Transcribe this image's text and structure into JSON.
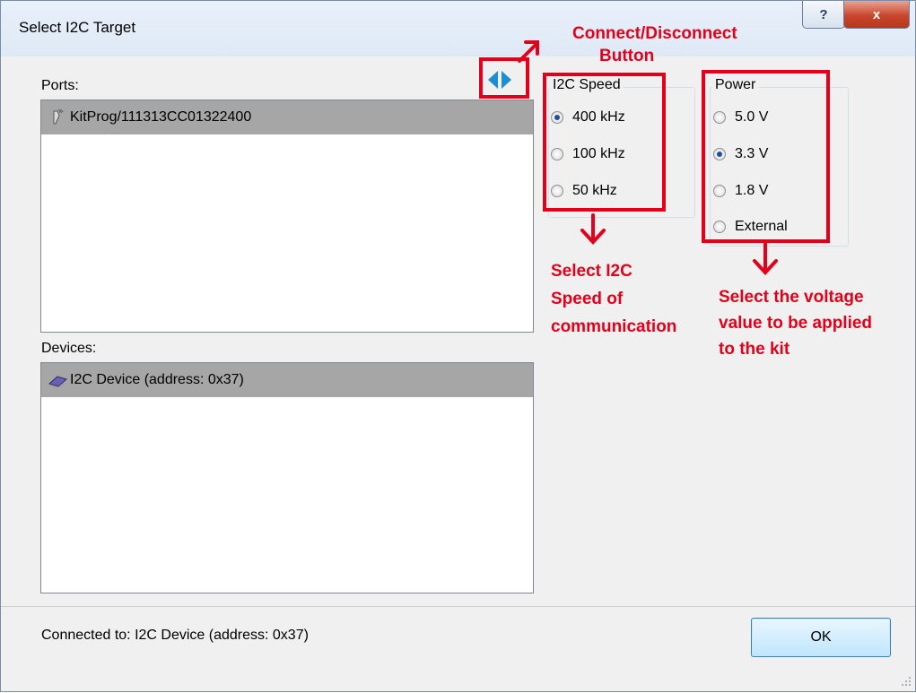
{
  "window": {
    "title": "Select I2C Target",
    "help_label": "?",
    "close_label": "x"
  },
  "ports": {
    "label": "Ports:",
    "items": [
      "KitProg/111313CC01322400"
    ]
  },
  "devices": {
    "label": "Devices:",
    "items": [
      "I2C Device (address: 0x37)"
    ]
  },
  "i2c_speed": {
    "title": "I2C Speed",
    "options": [
      "400 kHz",
      "100 kHz",
      "50 kHz"
    ],
    "selected": "400 kHz"
  },
  "power": {
    "title": "Power",
    "options": [
      "5.0 V",
      "3.3 V",
      "1.8 V",
      "External"
    ],
    "selected": "3.3 V"
  },
  "annotations": {
    "connect_line1": "Connect/Disconnect",
    "connect_line2": "Button",
    "speed_line1": "Select I2C",
    "speed_line2": "Speed of",
    "speed_line3": "communication",
    "power_line1": "Select the voltage",
    "power_line2": "value to be applied",
    "power_line3": "to the kit"
  },
  "status": {
    "text": "Connected to: I2C Device (address: 0x37)"
  },
  "buttons": {
    "ok": "OK"
  },
  "colors": {
    "annotation_red": "#e3001b",
    "selected_row": "#a6a6a6",
    "connect_icon": "#1c8fd0"
  },
  "icons": {
    "port": "usb-probe-icon",
    "device": "chip-icon",
    "connect": "connect-disconnect-icon"
  }
}
